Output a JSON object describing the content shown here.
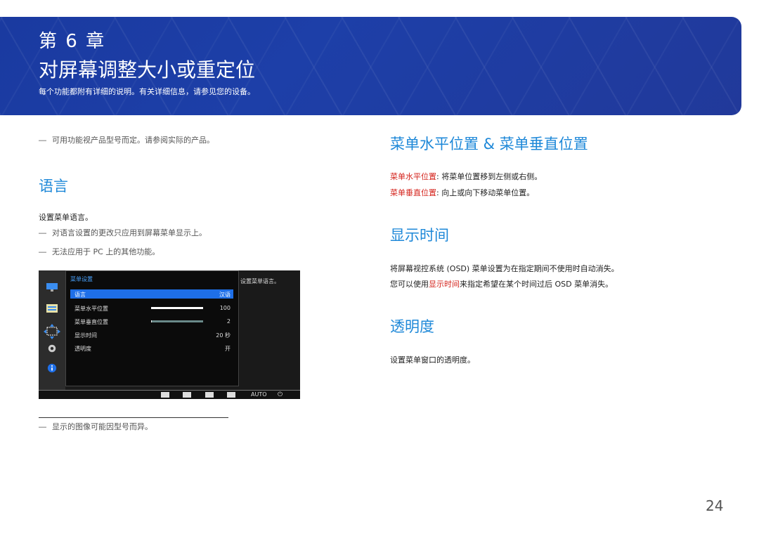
{
  "banner": {
    "chapter": "第 6 章",
    "title": "对屏幕调整大小或重定位",
    "subtitle": "每个功能都附有详细的说明。有关详细信息，请参见您的设备。"
  },
  "left": {
    "note_top": "可用功能视产品型号而定。请参阅实际的产品。",
    "lang_heading": "语言",
    "lang_desc": "设置菜单语言。",
    "lang_note1": "对语言设置的更改只应用到屏幕菜单显示上。",
    "lang_note2": "无法应用于 PC 上的其他功能。",
    "bottom_note": "显示的图像可能因型号而异。",
    "dash": "―"
  },
  "osd": {
    "header": "菜单设置",
    "help": "设置菜单语言。",
    "rows": [
      {
        "label": "语言",
        "value": "汉语"
      },
      {
        "label": "菜单水平位置",
        "value": "100",
        "level": 1.0
      },
      {
        "label": "菜单垂直位置",
        "value": "2",
        "level": 0.02
      },
      {
        "label": "显示时间",
        "value": "20 秒"
      },
      {
        "label": "透明度",
        "value": "开"
      }
    ],
    "auto": "AUTO",
    "icons": [
      "monitor-icon",
      "picture-icon",
      "position-icon",
      "gear-icon",
      "info-icon"
    ]
  },
  "right": {
    "pos_heading": "菜单水平位置 & 菜单垂直位置",
    "pos_h_label": "菜单水平位置",
    "pos_h_text": ": 将菜单位置移到左侧或右侧。",
    "pos_v_label": "菜单垂直位置",
    "pos_v_text": ": 向上或向下移动菜单位置。",
    "time_heading": "显示时间",
    "time_p1": "将屏幕视控系统 (OSD) 菜单设置为在指定期间不使用时自动消失。",
    "time_p2_a": "您可以使用",
    "time_p2_link": "显示时间",
    "time_p2_b": "来指定希望在某个时间过后 OSD 菜单消失。",
    "trans_heading": "透明度",
    "trans_desc": "设置菜单窗口的透明度。"
  },
  "page_number": "24",
  "colors": {
    "accent": "#1e88d8",
    "banner": "#1d3fa8",
    "highlight": "#d4221b"
  }
}
